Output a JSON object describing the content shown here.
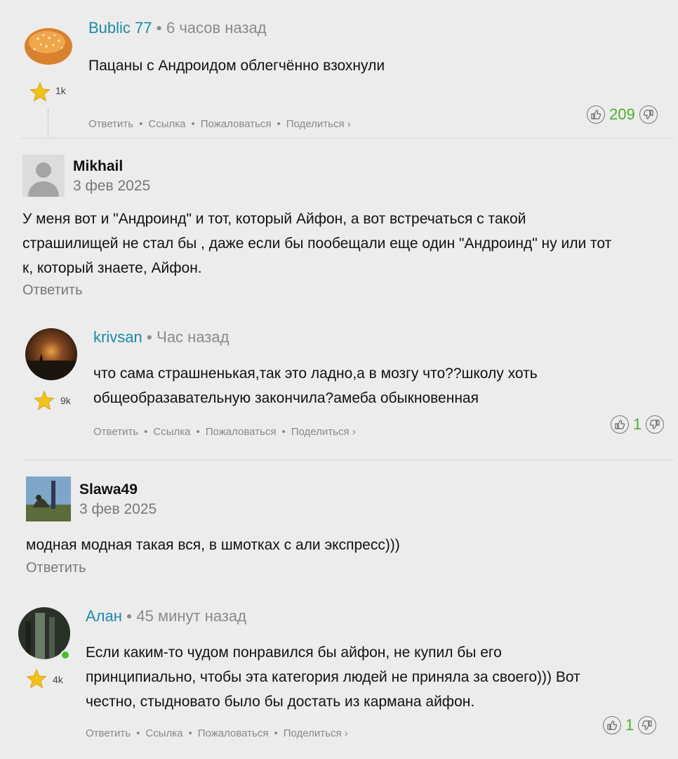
{
  "comments": [
    {
      "author": "Bublic 77",
      "time": "6 часов назад",
      "text": "Пацаны с Андроидом облегчённо взохнули",
      "karma": "1k",
      "actions": [
        "Ответить",
        "Ссылка",
        "Пожаловаться",
        "Поделиться ›"
      ],
      "votes": "209"
    },
    {
      "author": "Mikhail",
      "date": "3 фев 2025",
      "text_lines": [
        "У меня вот и \"Андроинд\" и тот, который Айфон, а вот встречаться с такой",
        "страшилищей не стал бы , даже если бы пообещали еще один \"Андроинд\" ну или тот",
        "к, который знаете, Айфон."
      ],
      "reply": "Ответить"
    },
    {
      "author": "krivsan",
      "time": "Час назад",
      "text_lines": [
        "что сама страшненькая,так это ладно,а в мозгу что??школу хоть",
        "общеобразавательную закончила?амеба обыкновенная"
      ],
      "karma": "9k",
      "actions": [
        "Ответить",
        "Ссылка",
        "Пожаловаться",
        "Поделиться ›"
      ],
      "votes": "1"
    },
    {
      "author": "Slawa49",
      "date": "3 фев 2025",
      "text": "модная модная такая вся, в шмотках с али экспресс)))",
      "reply": "Ответить"
    },
    {
      "author": "Алан",
      "time": "45 минут назад",
      "text_lines": [
        "Если каким-то чудом понравился бы айфон, не купил бы его",
        "принципиально, чтобы эта категория людей не приняла за своего))) Вот",
        "честно, стыдновато было бы достать из кармана айфон."
      ],
      "karma": "4k",
      "actions": [
        "Ответить",
        "Ссылка",
        "Пожаловаться",
        "Поделиться ›"
      ],
      "votes": "1"
    }
  ],
  "colors": {
    "author_link": "#1a8aa6",
    "vote_count": "#4caf2a",
    "background": "#ececec"
  }
}
